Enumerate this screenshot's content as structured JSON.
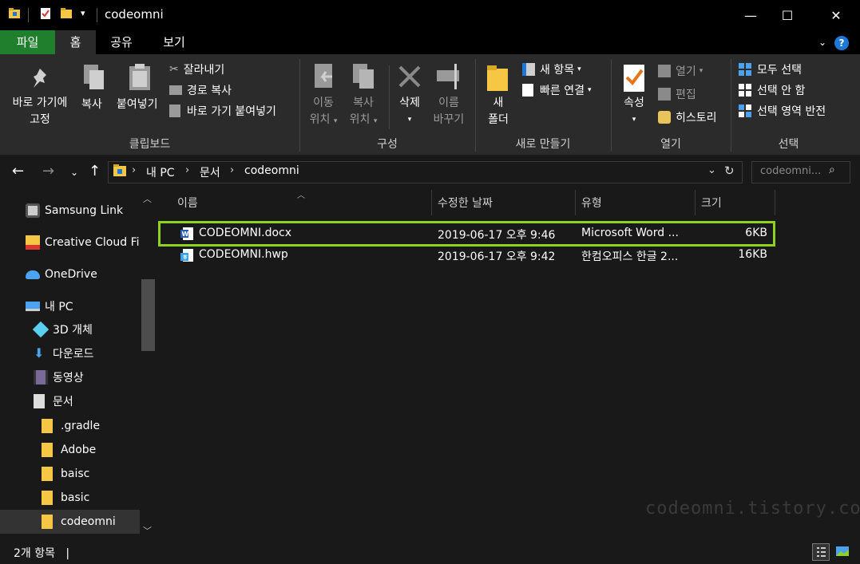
{
  "window": {
    "title": "codeomni",
    "minimize": "—",
    "maximize": "☐",
    "close": "✕"
  },
  "tabs": {
    "file": "파일",
    "home": "홈",
    "share": "공유",
    "view": "보기",
    "help": "?"
  },
  "ribbon": {
    "pin": [
      "바로 가기에",
      "고정"
    ],
    "copy": "복사",
    "paste": "붙여넣기",
    "cut": "잘라내기",
    "copy_path": "경로 복사",
    "paste_shortcut": "바로 가기 붙여넣기",
    "group_clipboard": "클립보드",
    "move_to": [
      "이동",
      "위치"
    ],
    "copy_to": [
      "복사",
      "위치"
    ],
    "delete": "삭제",
    "rename": [
      "이름",
      "바꾸기"
    ],
    "group_organize": "구성",
    "new_folder": [
      "새",
      "폴더"
    ],
    "new_item": "새 항목",
    "easy_access": "빠른 연결",
    "group_new": "새로 만들기",
    "properties": "속성",
    "open": "열기",
    "edit": "편집",
    "history": "히스토리",
    "group_open": "열기",
    "select_all": "모두 선택",
    "select_none": "선택 안 함",
    "invert_selection": "선택 영역 반전",
    "group_select": "선택"
  },
  "address": {
    "crumbs": [
      "내 PC",
      "문서",
      "codeomni"
    ],
    "search_placeholder": "codeomni..."
  },
  "nav": {
    "items": [
      {
        "label": "Samsung Link",
        "icon": "samsung-link-icon"
      },
      {
        "label": "Creative Cloud Fil",
        "icon": "creative-cloud-icon"
      },
      {
        "label": "OneDrive",
        "icon": "onedrive-icon"
      },
      {
        "label": "내 PC",
        "icon": "pc-icon"
      },
      {
        "label": "3D 개체",
        "icon": "3d-objects-icon"
      },
      {
        "label": "다운로드",
        "icon": "download-icon"
      },
      {
        "label": "동영상",
        "icon": "video-icon"
      },
      {
        "label": "문서",
        "icon": "documents-icon"
      },
      {
        "label": ".gradle",
        "icon": "folder-icon"
      },
      {
        "label": "Adobe",
        "icon": "folder-icon"
      },
      {
        "label": "baisc",
        "icon": "folder-icon"
      },
      {
        "label": "basic",
        "icon": "folder-icon"
      },
      {
        "label": "codeomni",
        "icon": "folder-icon"
      }
    ]
  },
  "columns": {
    "name": "이름",
    "modified": "수정한 날짜",
    "type": "유형",
    "size": "크기"
  },
  "files": [
    {
      "name": "CODEOMNI.docx",
      "modified": "2019-06-17 오후 9:46",
      "type": "Microsoft Word ...",
      "size": "6KB",
      "icon": "word-doc-icon"
    },
    {
      "name": "CODEOMNI.hwp",
      "modified": "2019-06-17 오후 9:42",
      "type": "한컴오피스 한글 2...",
      "size": "16KB",
      "icon": "hwp-doc-icon"
    }
  ],
  "status": {
    "count": "2개 항목",
    "cursor": "|"
  },
  "watermark": "codeomni.tistory.com",
  "colors": {
    "accent_green": "#1f7f2d",
    "highlight": "#8fd21d",
    "folder": "#f6c744",
    "blue": "#1e78d7"
  }
}
